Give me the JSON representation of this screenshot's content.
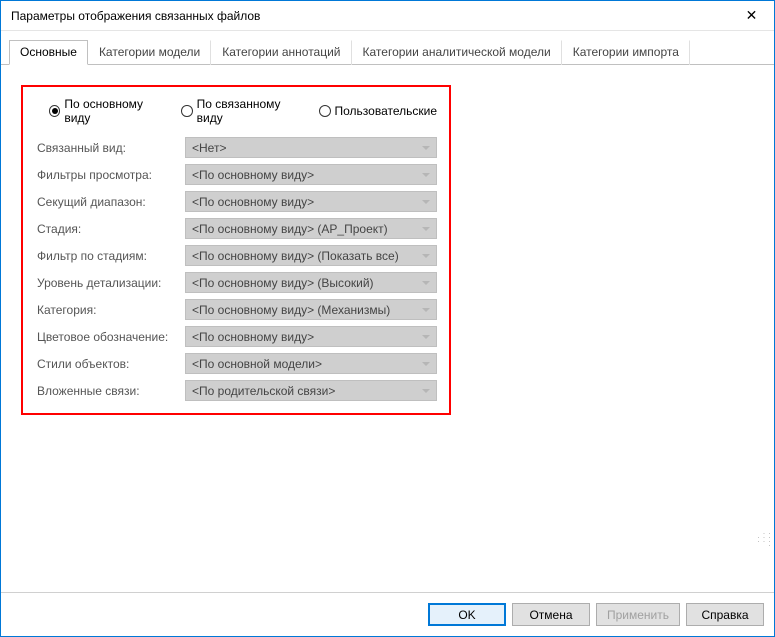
{
  "window": {
    "title": "Параметры отображения связанных файлов",
    "close_glyph": "✕"
  },
  "tabs": [
    {
      "label": "Основные",
      "active": true
    },
    {
      "label": "Категории модели",
      "active": false
    },
    {
      "label": "Категории аннотаций",
      "active": false
    },
    {
      "label": "Категории аналитической модели",
      "active": false
    },
    {
      "label": "Категории импорта",
      "active": false
    }
  ],
  "radios": [
    {
      "label": "По основному виду",
      "checked": true
    },
    {
      "label": "По связанному виду",
      "checked": false
    },
    {
      "label": "Пользовательские",
      "checked": false
    }
  ],
  "fields": [
    {
      "label": "Связанный вид:",
      "value": "<Нет>"
    },
    {
      "label": "Фильтры просмотра:",
      "value": "<По основному виду>"
    },
    {
      "label": "Секущий диапазон:",
      "value": "<По основному виду>"
    },
    {
      "label": "Стадия:",
      "value": "<По основному виду> (АР_Проект)"
    },
    {
      "label": "Фильтр по стадиям:",
      "value": "<По основному виду> (Показать все)"
    },
    {
      "label": "Уровень детализации:",
      "value": "<По основному виду> (Высокий)"
    },
    {
      "label": "Категория:",
      "value": "<По основному виду> (Механизмы)"
    },
    {
      "label": "Цветовое обозначение:",
      "value": "<По основному виду>"
    },
    {
      "label": "Стили объектов:",
      "value": "<По основной модели>"
    },
    {
      "label": "Вложенные связи:",
      "value": "<По родительской связи>"
    }
  ],
  "footer": {
    "ok": "OK",
    "cancel": "Отмена",
    "apply": "Применить",
    "help": "Справка"
  }
}
